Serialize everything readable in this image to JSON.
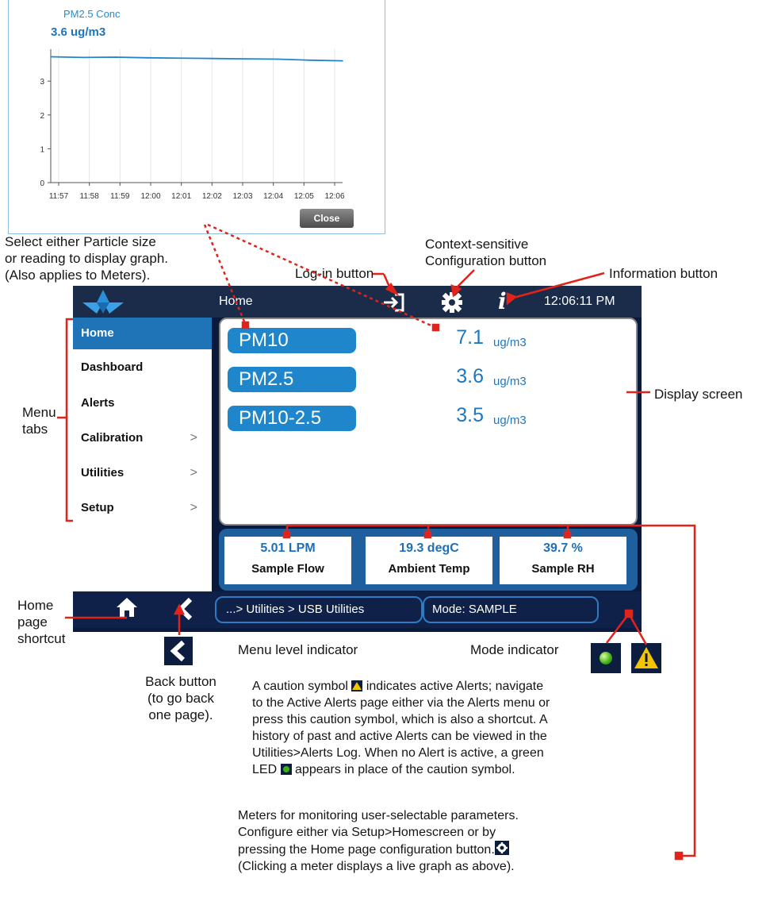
{
  "graph": {
    "title": "PM2.5 Conc",
    "value": "3.6 ug/m3",
    "y_ticks": [
      "0",
      "1",
      "2",
      "3"
    ],
    "x_ticks": [
      "11:57",
      "11:58",
      "11:59",
      "12:00",
      "12:01",
      "12:02",
      "12:03",
      "12:04",
      "12:05",
      "12:06"
    ],
    "close_label": "Close"
  },
  "chart_data": {
    "type": "line",
    "title": "PM2.5 Conc",
    "x": [
      "11:57",
      "11:58",
      "11:59",
      "12:00",
      "12:01",
      "12:02",
      "12:03",
      "12:04",
      "12:05",
      "12:06"
    ],
    "series": [
      {
        "values": [
          3.72,
          3.7,
          3.71,
          3.69,
          3.68,
          3.67,
          3.66,
          3.65,
          3.62,
          3.6
        ]
      }
    ],
    "ylim": [
      0,
      3.85
    ],
    "grid": true
  },
  "annotations": {
    "select_graph": [
      "Select either Particle size",
      "or reading to display graph.",
      "(Also applies to Meters)."
    ],
    "login_button": "Log-in button",
    "config_button": [
      "Context-sensitive",
      "Configuration button"
    ],
    "info_button": "Information button",
    "menu_tabs": [
      "Menu",
      "tabs"
    ],
    "display_screen": "Display screen",
    "home_shortcut": [
      "Home",
      "page",
      "shortcut"
    ],
    "menu_level": "Menu level indicator",
    "mode_indicator": "Mode indicator",
    "back_button": [
      "Back button",
      "(to go back",
      "one page)."
    ],
    "caution_text": [
      [
        "A caution symbol ",
        " indicates active Alerts; navigate"
      ],
      "to the Active Alerts page either via the Alerts menu or",
      "press this caution symbol, which is also a shortcut. A",
      "history of past and active Alerts can be viewed in the",
      "Utilities>Alerts Log. When no Alert is active, a green",
      [
        "LED ",
        " appears in place of the caution symbol."
      ]
    ],
    "meters_text": [
      "Meters for monitoring user-selectable parameters.",
      "Configure either via Setup>Homescreen or by",
      "pressing the Home page configuration button.",
      "(Clicking a meter displays a live graph as above)."
    ]
  },
  "screen": {
    "title": "Home",
    "clock": "12:06:11 PM",
    "menu": [
      {
        "label": "Home",
        "active": true,
        "submenu": false
      },
      {
        "label": "Dashboard",
        "active": false,
        "submenu": false
      },
      {
        "label": "Alerts",
        "active": false,
        "submenu": false
      },
      {
        "label": "Calibration",
        "active": false,
        "submenu": true
      },
      {
        "label": "Utilities",
        "active": false,
        "submenu": true
      },
      {
        "label": "Setup",
        "active": false,
        "submenu": true
      }
    ],
    "chevron": ">",
    "readings": [
      {
        "name": "PM10",
        "value": "7.1",
        "unit": "ug/m3"
      },
      {
        "name": "PM2.5",
        "value": "3.6",
        "unit": "ug/m3"
      },
      {
        "name": "PM10-2.5",
        "value": "3.5",
        "unit": "ug/m3"
      }
    ],
    "meters": [
      {
        "value": "5.01 LPM",
        "label": "Sample Flow"
      },
      {
        "value": "19.3 degC",
        "label": "Ambient Temp"
      },
      {
        "value": "39.7 %",
        "label": "Sample RH"
      }
    ],
    "breadcrumb": "...> Utilities > USB Utilities",
    "mode": "Mode: SAMPLE"
  },
  "colors": {
    "accent_blue": "#1f86cc",
    "screen_dark": "#0a1a3c",
    "leader_red": "#e2231a",
    "caution_yellow": "#f5c400",
    "led_green": "#3cae16"
  },
  "icons": [
    "logo-icon",
    "login-icon",
    "gear-icon",
    "info-icon",
    "home-icon",
    "back-icon",
    "led-icon",
    "caution-icon"
  ]
}
